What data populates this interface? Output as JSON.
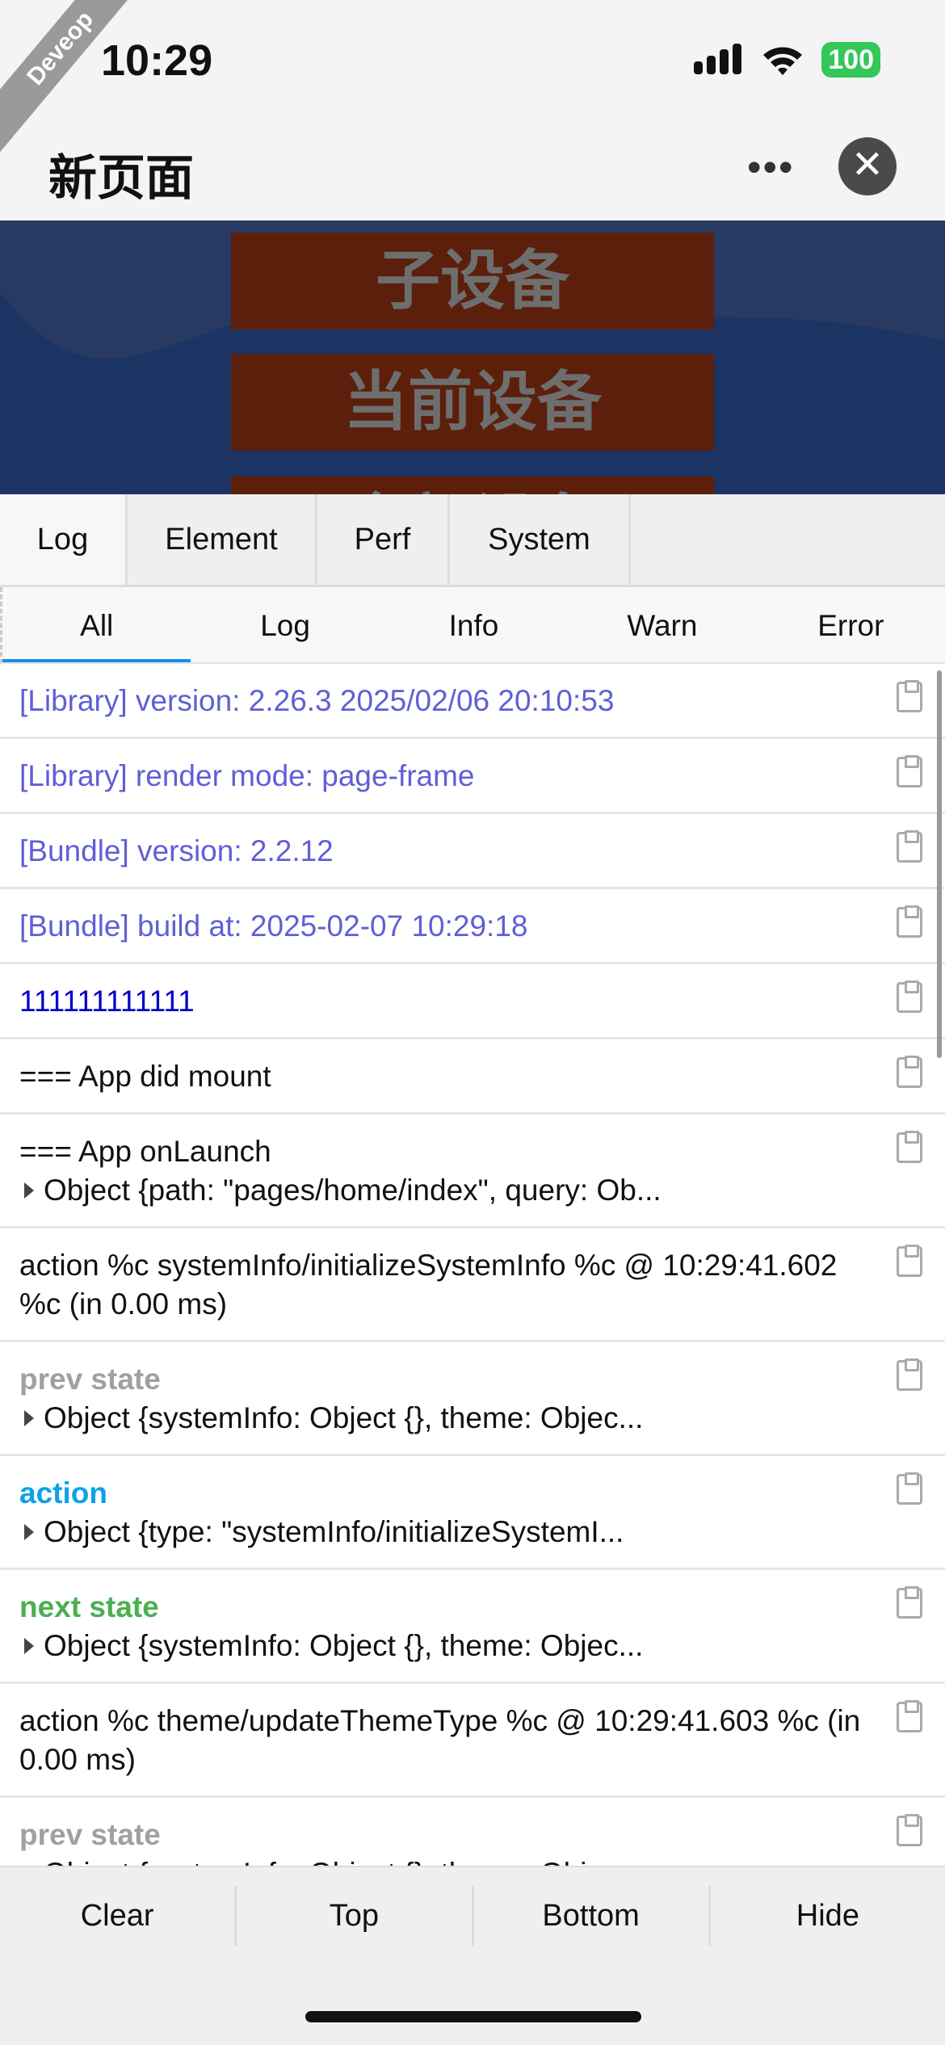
{
  "status": {
    "time": "10:29",
    "battery": "100",
    "ribbon": "Deveop"
  },
  "nav": {
    "title": "新页面",
    "more": "•••",
    "close": "✕"
  },
  "banner": {
    "buttons": [
      "子设备",
      "当前设备",
      "全部设备"
    ]
  },
  "tabs": [
    "Log",
    "Element",
    "Perf",
    "System"
  ],
  "subtabs": [
    "All",
    "Log",
    "Info",
    "Warn",
    "Error"
  ],
  "logs": [
    {
      "l1": "[Library] version: 2.26.3 2025/02/06 20:10:53",
      "c": "purple"
    },
    {
      "l1": "[Library] render mode: page-frame",
      "c": "purple"
    },
    {
      "l1": "[Bundle] version: 2.2.12",
      "c": "purple"
    },
    {
      "l1": "[Bundle] build at: 2025-02-07 10:29:18",
      "c": "purple"
    },
    {
      "l1": "111111111111",
      "c": "navy"
    },
    {
      "l1": "=== App did mount",
      "c": ""
    },
    {
      "l1": "=== App onLaunch",
      "c": "",
      "obj": "Object {path: \"pages/home/index\", query: Ob..."
    },
    {
      "l1": "action  %c systemInfo/initializeSystemInfo  %c @ 10:29:41.602  %c (in 0.00 ms)",
      "c": ""
    },
    {
      "l1": "prev state",
      "c": "gray",
      "obj": "Object {systemInfo: Object {}, theme: Objec..."
    },
    {
      "l1": "action",
      "c": "blue",
      "obj": "Object {type: \"systemInfo/initializeSystemI..."
    },
    {
      "l1": "next state",
      "c": "green",
      "obj": "Object {systemInfo: Object {}, theme: Objec..."
    },
    {
      "l1": "action  %c theme/updateThemeType  %c @ 10:29:41.603  %c (in 0.00 ms)",
      "c": ""
    },
    {
      "l1": "prev state",
      "c": "gray",
      "obj": "Object {systemInfo: Object {}, theme: Objec..."
    }
  ],
  "toolbar": [
    "Clear",
    "Top",
    "Bottom",
    "Hide"
  ]
}
